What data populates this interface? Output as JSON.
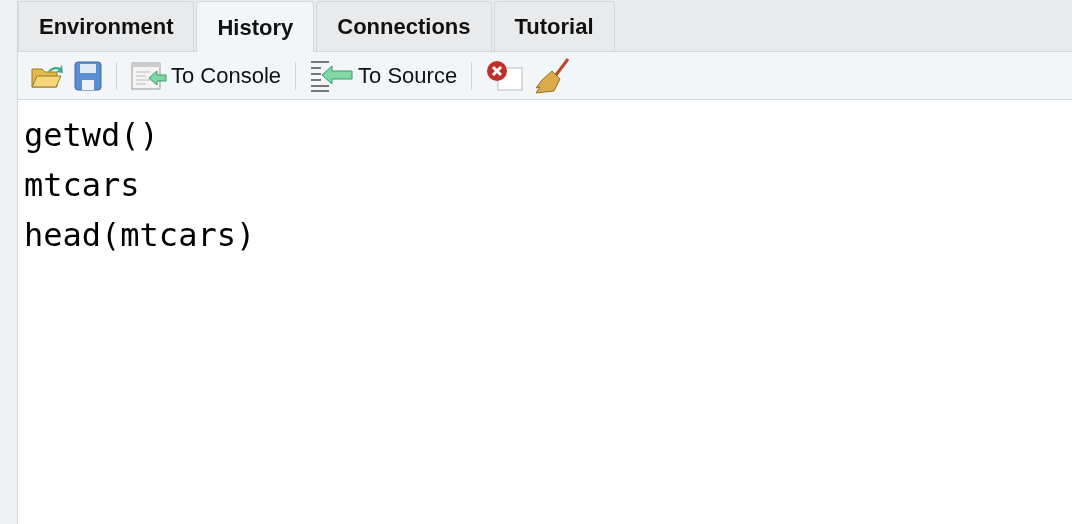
{
  "tabs": [
    {
      "label": "Environment",
      "selected": false
    },
    {
      "label": "History",
      "selected": true
    },
    {
      "label": "Connections",
      "selected": false
    },
    {
      "label": "Tutorial",
      "selected": false
    }
  ],
  "toolbar": {
    "to_console": "To Console",
    "to_source": "To Source"
  },
  "history": [
    "getwd()",
    "mtcars",
    "head(mtcars)"
  ]
}
